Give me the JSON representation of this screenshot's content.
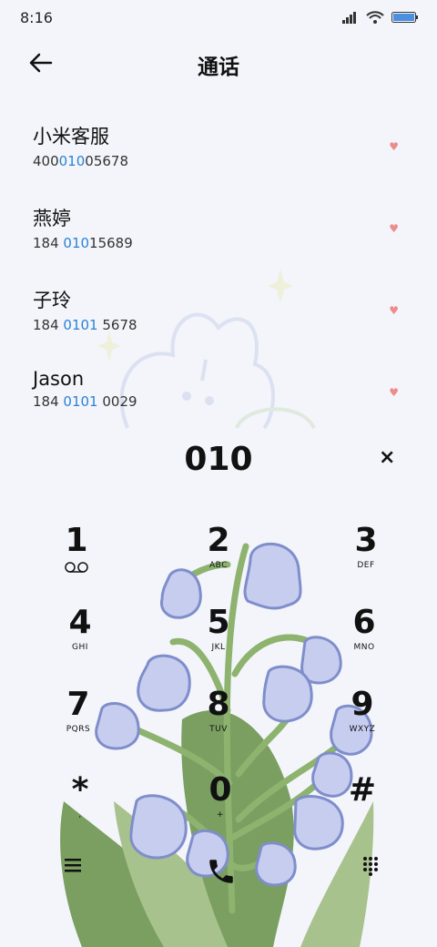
{
  "status": {
    "time": "8:16",
    "icons": [
      "signal-icon",
      "wifi-icon",
      "battery-icon"
    ]
  },
  "header": {
    "title": "通话",
    "back_icon": "back-arrow-icon"
  },
  "contacts": [
    {
      "name": "小米客服",
      "num_pre": "400",
      "num_hl": "010",
      "num_post": "05678"
    },
    {
      "name": "燕婷",
      "num_pre": "184 ",
      "num_hl": "010",
      "num_post": "15689"
    },
    {
      "name": "子玲",
      "num_pre": "184 ",
      "num_hl": "0101",
      "num_post": " 5678"
    },
    {
      "name": "Jason",
      "num_pre": "184 ",
      "num_hl": "0101",
      "num_post": " 0029"
    }
  ],
  "dialer": {
    "input": "010",
    "clear_icon": "close-icon",
    "keys": [
      {
        "digit": "1",
        "letters": ""
      },
      {
        "digit": "2",
        "letters": "ABC"
      },
      {
        "digit": "3",
        "letters": "DEF"
      },
      {
        "digit": "4",
        "letters": "GHI"
      },
      {
        "digit": "5",
        "letters": "JKL"
      },
      {
        "digit": "6",
        "letters": "MNO"
      },
      {
        "digit": "7",
        "letters": "PQRS"
      },
      {
        "digit": "8",
        "letters": "TUV"
      },
      {
        "digit": "9",
        "letters": "WXYZ"
      },
      {
        "digit": "*",
        "letters": ","
      },
      {
        "digit": "0",
        "letters": "+"
      },
      {
        "digit": "#",
        "letters": ""
      }
    ],
    "bottom_icons": [
      "menu-icon",
      "phone-call-icon",
      "keypad-icon"
    ]
  },
  "colors": {
    "accent": "#2b82d6",
    "heart": "#ee8c8c",
    "leaf": "#7ea36a",
    "flower": "#c7cdef"
  }
}
